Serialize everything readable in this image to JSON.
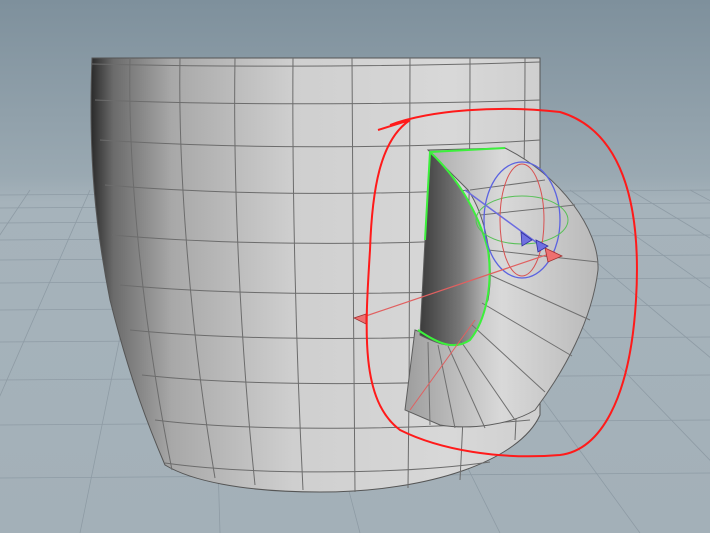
{
  "viewport": {
    "background_top": "#7f929f",
    "background_horizon": "#a9b5bd",
    "grid_color": "#7c8a94",
    "floor_color": "#aab7bf"
  },
  "model": {
    "name": "mug",
    "mesh_color": "#cfcfcf",
    "wire_color": "#6a6a6a",
    "selected_edge_color": "#33ff33"
  },
  "gizmo": {
    "x_axis_color": "#e04040",
    "y_axis_color": "#40c040",
    "z_axis_color": "#4050e0",
    "handle_color": "#f07070"
  },
  "annotation": {
    "color": "#ff1a1a"
  }
}
